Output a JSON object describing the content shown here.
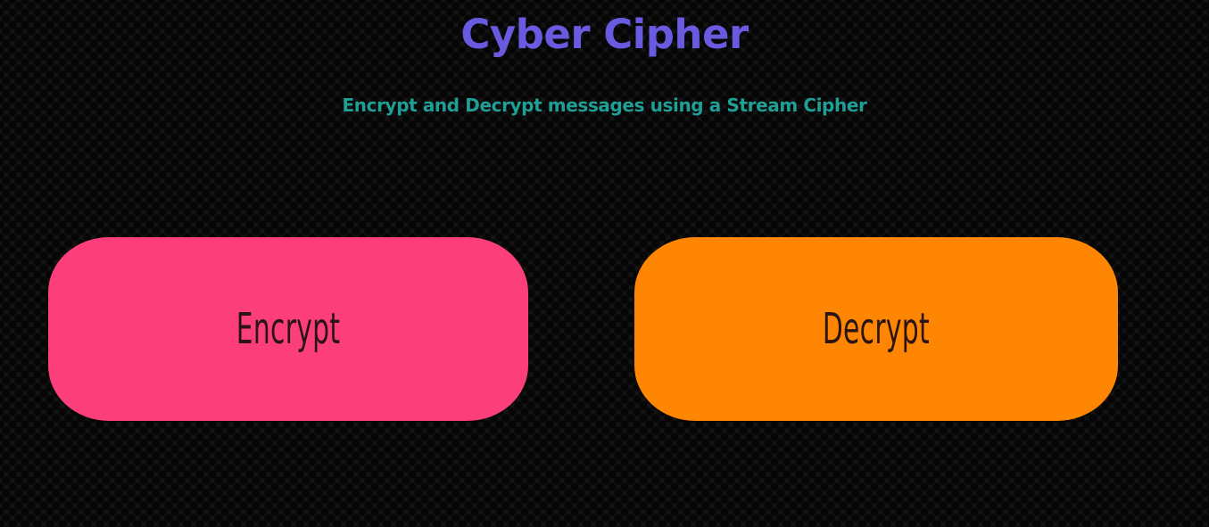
{
  "header": {
    "title": "Cyber Cipher",
    "subtitle": "Encrypt and Decrypt messages using a Stream Cipher"
  },
  "actions": {
    "encrypt_label": "Encrypt",
    "decrypt_label": "Decrypt"
  },
  "colors": {
    "background": "#141414",
    "title": "#6a5ae0",
    "subtitle": "#1f9f95",
    "encrypt_button": "#fc3f7b",
    "decrypt_button": "#fe8603",
    "button_text": "#2a1414"
  }
}
